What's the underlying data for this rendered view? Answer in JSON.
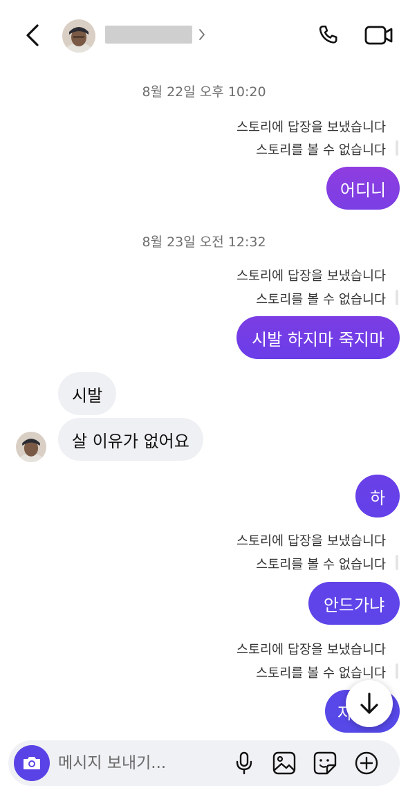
{
  "header": {
    "back_icon": "chevron-left-icon",
    "avatar": "profile-photo",
    "name_chevron_icon": "chevron-right-icon",
    "call_icon": "phone-icon",
    "video_icon": "video-camera-icon"
  },
  "conversation": {
    "timestamp_1": "8월 22일 오후 10:20",
    "timestamp_2": "8월 23일 오전 12:32",
    "story_reply": "스토리에 답장을 보냈습니다",
    "story_unavailable": "스토리를 볼 수 없습니다",
    "out_msg_1": "어디니",
    "out_msg_2": "시발 하지마 죽지마",
    "in_msg_1": "시발",
    "in_msg_2": "살 이유가 없어요",
    "out_msg_3": "하",
    "out_msg_4": "안드가냐",
    "out_msg_5": "자"
  },
  "composer": {
    "placeholder": "메시지 보내기...",
    "value": "",
    "camera_icon": "camera-icon",
    "mic_icon": "microphone-icon",
    "gallery_icon": "image-icon",
    "sticker_icon": "sticker-icon",
    "plus_icon": "plus-circle-icon"
  },
  "scroll_down_icon": "arrow-down-icon",
  "colors": {
    "bubble_gradient_top": "#8a3ee0",
    "bubble_gradient_mid": "#6a3de8",
    "bubble_gradient_bottom": "#5747e8",
    "accent": "#5a43e6",
    "incoming_bubble": "#eff0f3"
  }
}
